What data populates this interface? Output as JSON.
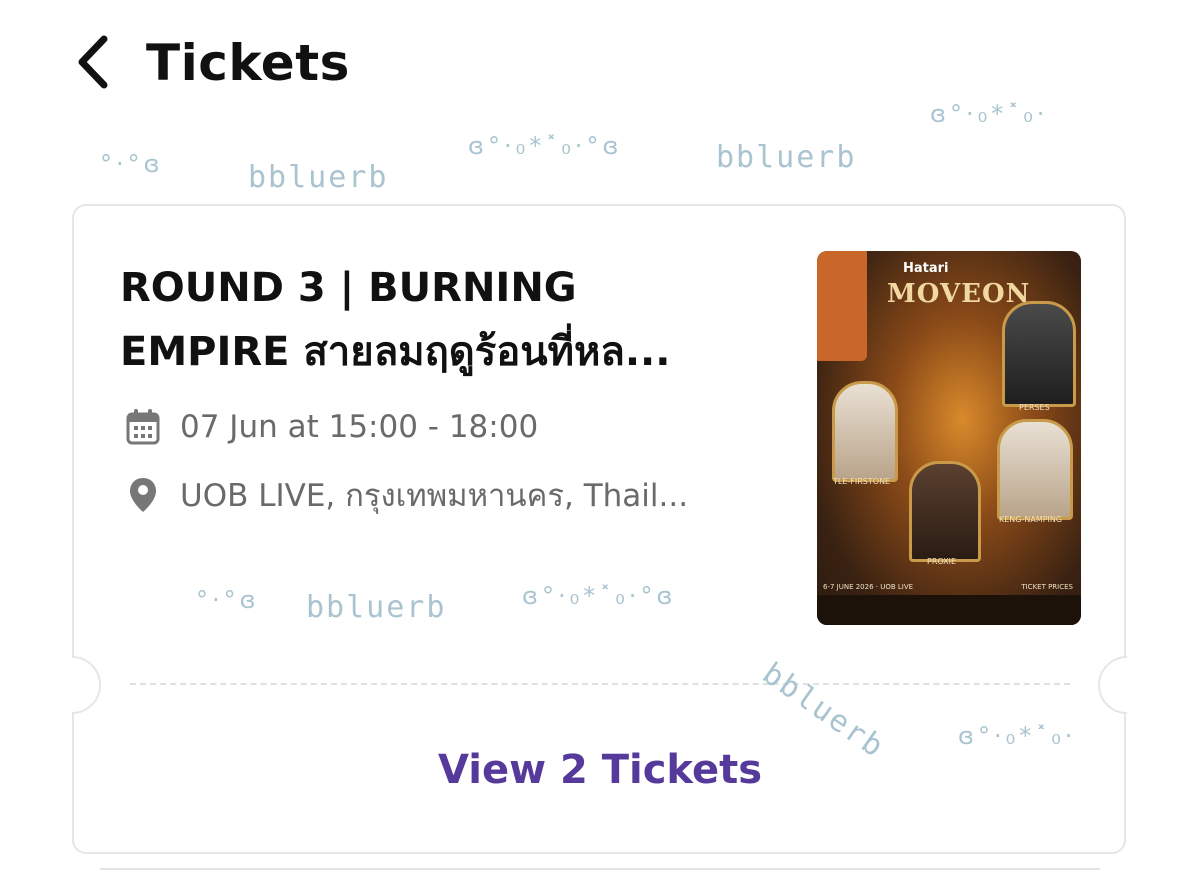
{
  "header": {
    "title": "Tickets",
    "back_icon": "chevron-left-icon"
  },
  "watermark": {
    "text": "bbluerb",
    "symbols_a": "ɞ°·₀*˟₀·°ɞ",
    "symbols_b": "°·°ɞ",
    "symbols_c": "ɞ°·₀*˟₀·"
  },
  "ticket": {
    "title_line1": "ROUND 3 | BURNING",
    "title_line2": "EMPIRE สายลมฤดูร้อนที่หล...",
    "date": "07 Jun at 15:00 - 18:00",
    "date_icon": "calendar-icon",
    "venue": "UOB LIVE, กรุงเทพมหานคร, Thail...",
    "venue_icon": "location-pin-icon",
    "poster": {
      "brand": "Hatari",
      "logo": "MOVEON",
      "labels": [
        "PERSES",
        "TLE-FIRSTONE",
        "KENG-NAMPING",
        "PROXIE"
      ],
      "footer_left": "6-7 JUNE 2026 · UOB LIVE",
      "footer_right": "TICKET PRICES"
    },
    "view_button_label": "View 2 Tickets"
  },
  "colors": {
    "accent": "#55399b",
    "muted_text": "#6a6a6a",
    "watermark": "#a9c4d0",
    "border": "#e6e6e6"
  }
}
